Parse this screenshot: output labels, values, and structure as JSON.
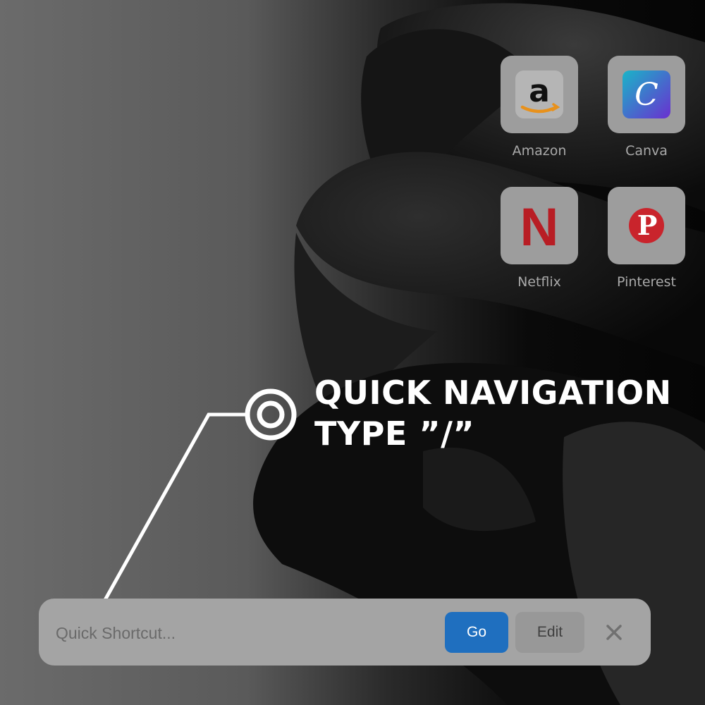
{
  "shortcuts": [
    {
      "label": "Amazon",
      "icon": "amazon-icon"
    },
    {
      "label": "Canva",
      "icon": "canva-icon"
    },
    {
      "label": "Netflix",
      "icon": "netflix-icon"
    },
    {
      "label": "Pinterest",
      "icon": "pinterest-icon"
    }
  ],
  "icon_glyphs": {
    "amazon": "a",
    "canva": "C",
    "netflix": "N",
    "pinterest": "P"
  },
  "callout": {
    "line1": "QUICK NAVIGATION",
    "line2": "TYPE ”/”",
    "icons": [
      "target-icon"
    ]
  },
  "quickbar": {
    "placeholder": "Quick Shortcut...",
    "go_label": "Go",
    "edit_label": "Edit",
    "close_glyph": "✕",
    "close_icon": "close-icon"
  },
  "colors": {
    "go_button": "#1f6fbf",
    "amazon_smile": "#e8911b",
    "canva_gradient_start": "#19b5c8",
    "canva_gradient_end": "#6a2fd0",
    "netflix": "#b81d24",
    "pinterest": "#c9242c"
  }
}
